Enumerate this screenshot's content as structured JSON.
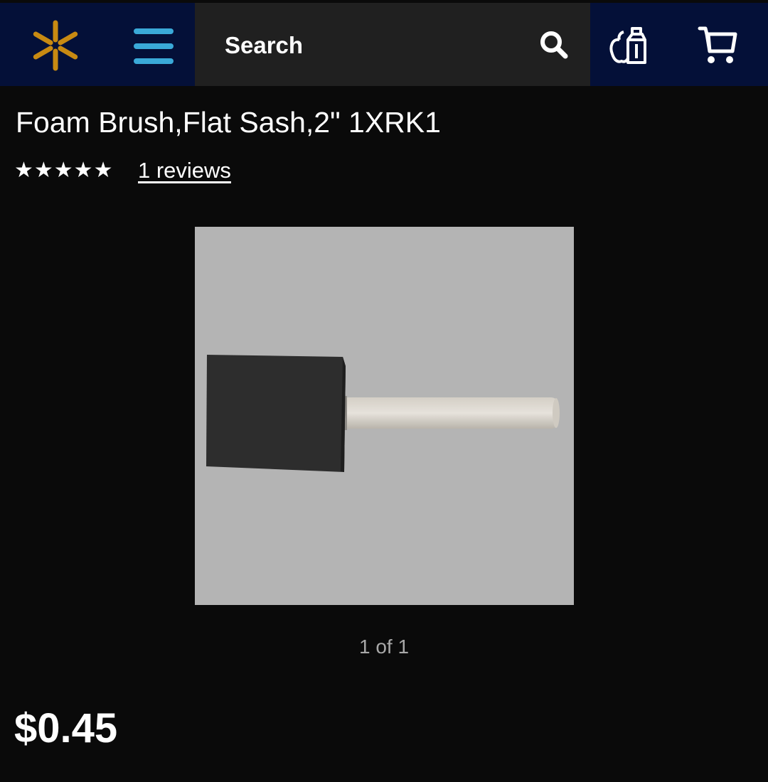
{
  "header": {
    "search_label": "Search",
    "icons": {
      "logo": "spark-icon",
      "menu": "menu-icon",
      "search": "search-icon",
      "grocery": "grocery-icon",
      "cart": "cart-icon"
    },
    "colors": {
      "bar": "#041038",
      "search_bg": "#202020",
      "spark": "#c88a12",
      "menu": "#3aa9d8"
    }
  },
  "product": {
    "title": "Foam Brush,Flat Sash,2\" 1XRK1",
    "stars_glyphs": "★★★★★",
    "rating": 5,
    "rating_max": 5,
    "reviews_label": "1 reviews",
    "image_pager": "1 of 1",
    "price": "$0.45"
  }
}
